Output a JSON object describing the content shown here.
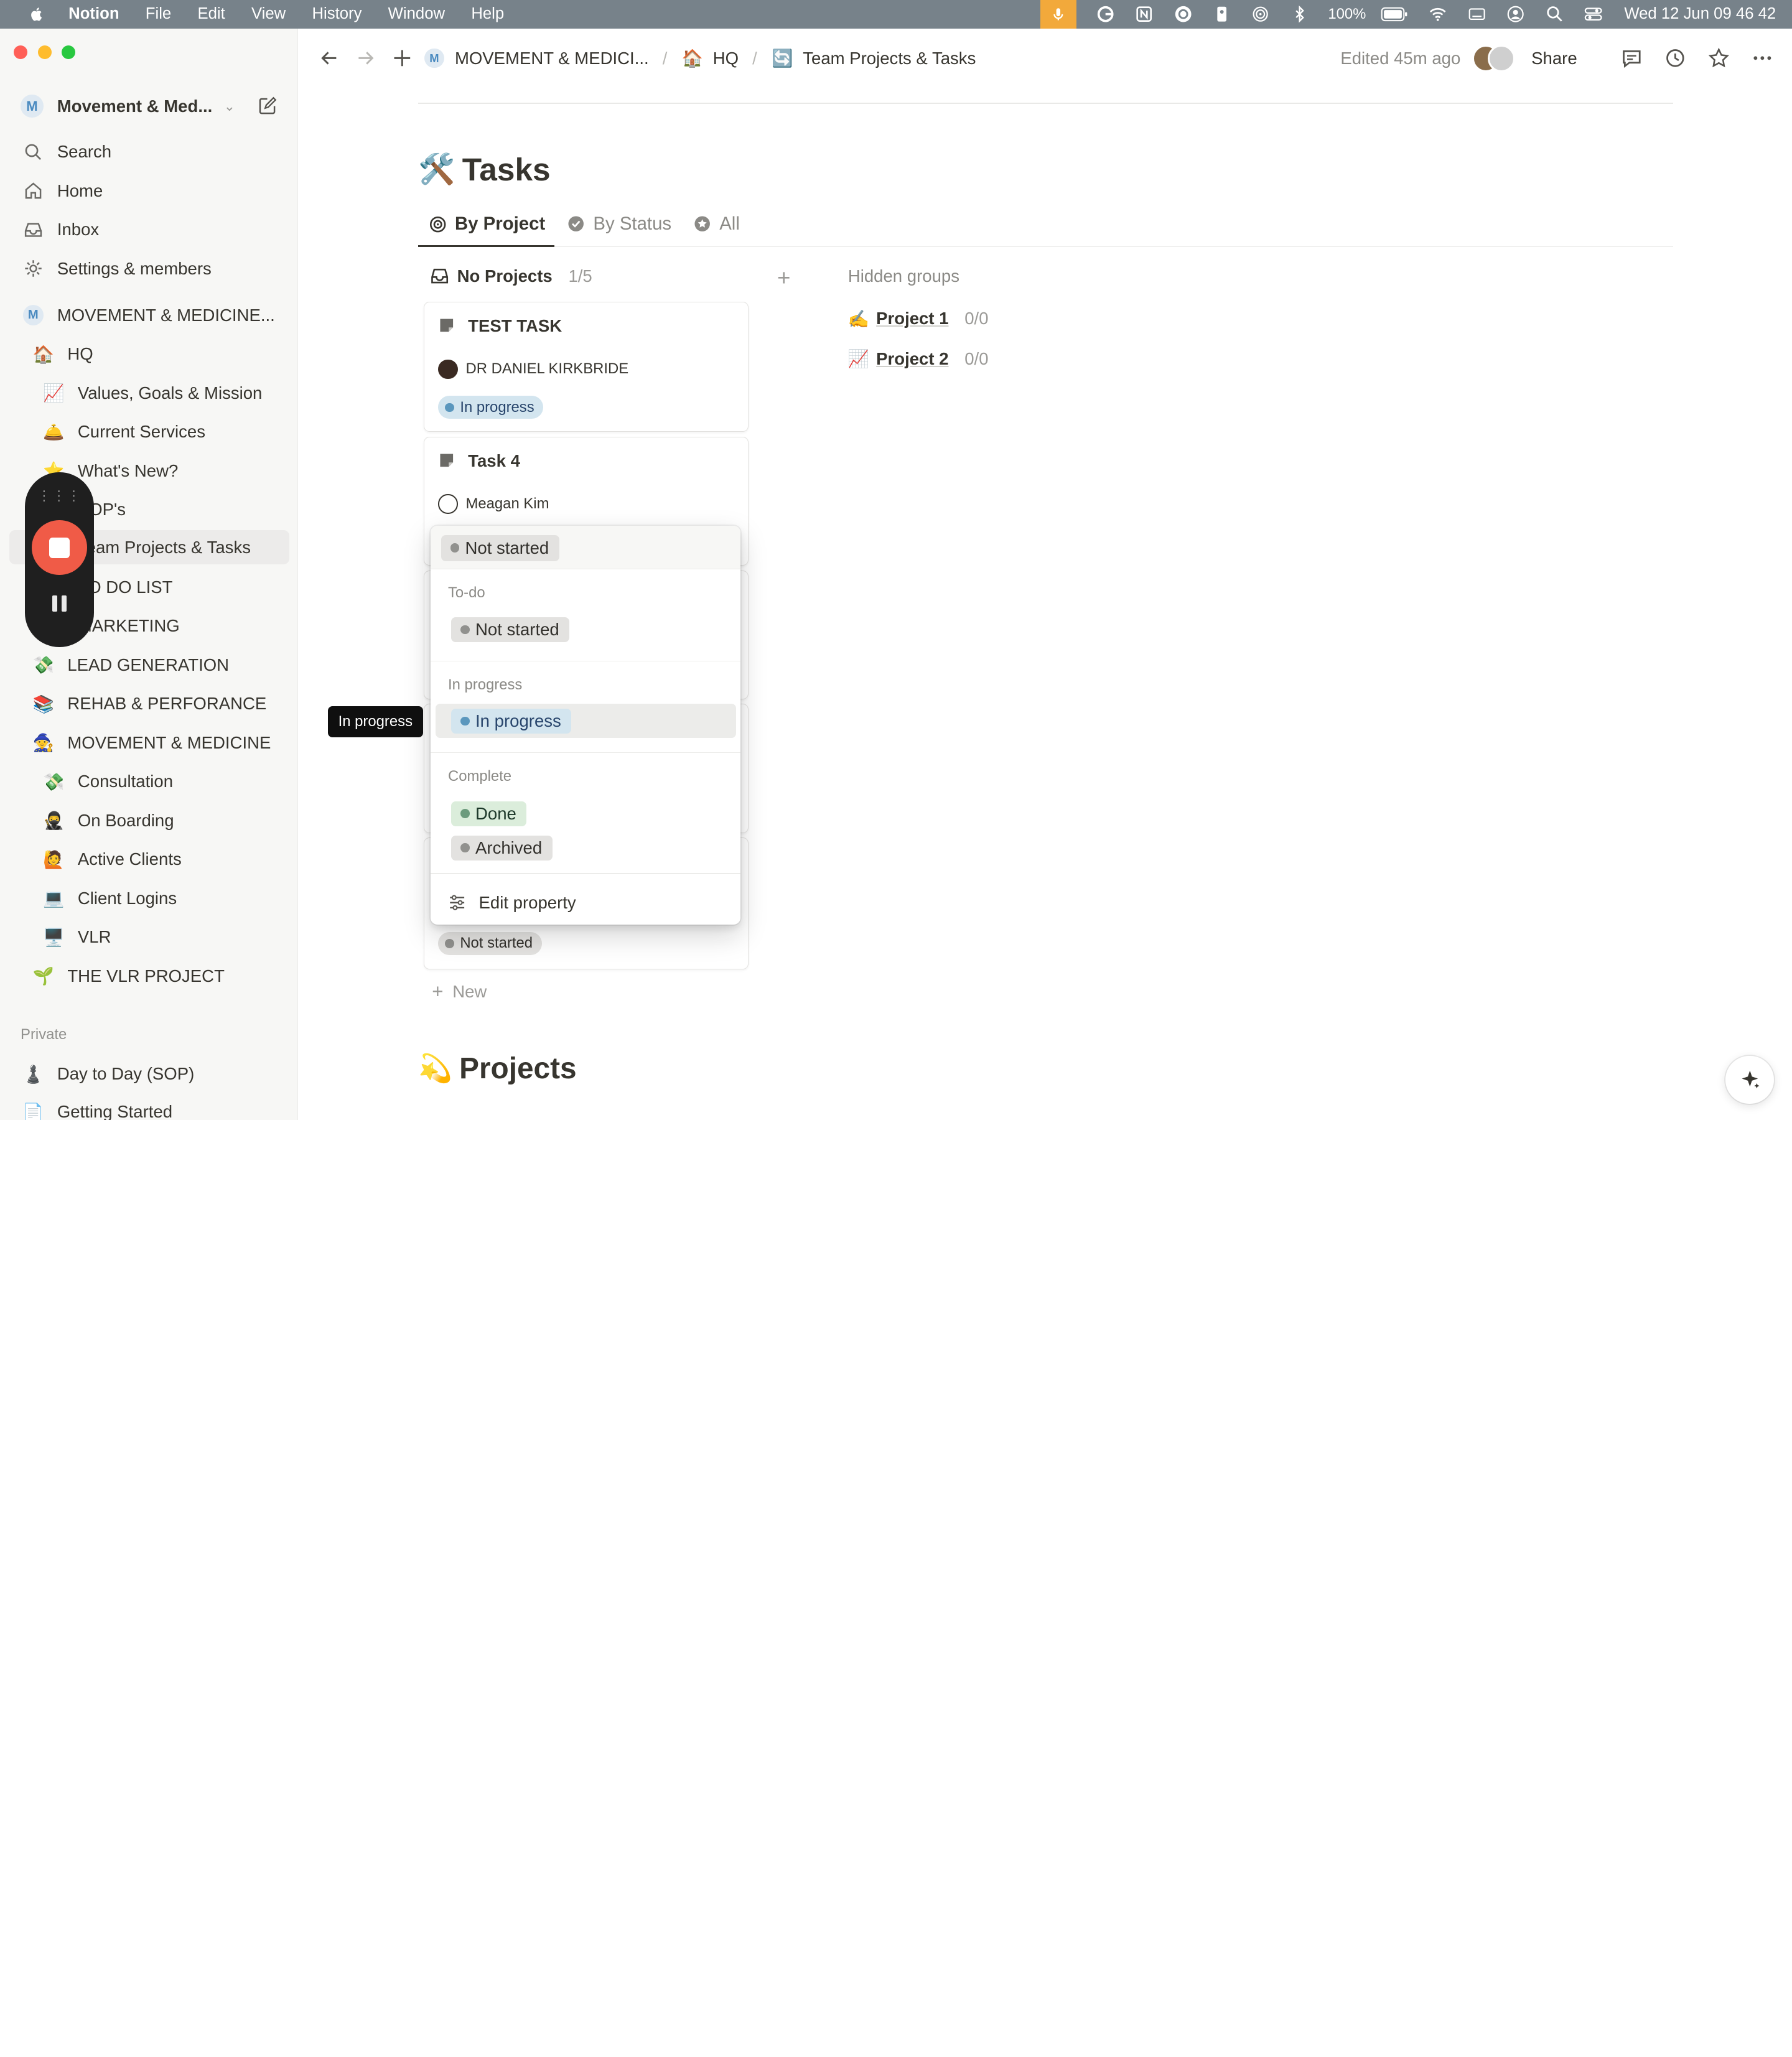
{
  "menubar": {
    "app": "Notion",
    "items": [
      "File",
      "Edit",
      "View",
      "History",
      "Window",
      "Help"
    ],
    "battery": "100%",
    "clock": "Wed 12 Jun  09 46 42"
  },
  "sidebar": {
    "workspace_name": "Movement & Med...",
    "nav": [
      {
        "label": "Search",
        "icon": "search-icon"
      },
      {
        "label": "Home",
        "icon": "home-icon"
      },
      {
        "label": "Inbox",
        "icon": "inbox-icon"
      },
      {
        "label": "Settings & members",
        "icon": "gear-icon"
      }
    ],
    "teamspace": "MOVEMENT & MEDICINE...",
    "pages": [
      {
        "emoji": "🏠",
        "label": "HQ"
      },
      {
        "emoji": "📈",
        "label": "Values, Goals & Mission"
      },
      {
        "emoji": "🛎️",
        "label": "Current Services"
      },
      {
        "emoji": "⭐",
        "label": "What's New?"
      },
      {
        "emoji": "📄",
        "label": "SOP's"
      },
      {
        "emoji": "🔄",
        "label": "Team Projects & Tasks"
      },
      {
        "emoji": "📝",
        "label": "TO DO LIST"
      },
      {
        "emoji": "📣",
        "label": "MARKETING"
      },
      {
        "emoji": "💸",
        "label": "LEAD GENERATION"
      },
      {
        "emoji": "📚",
        "label": "REHAB & PERFORANCE"
      },
      {
        "emoji": "🧙",
        "label": "MOVEMENT & MEDICINE"
      },
      {
        "emoji": "💸",
        "label": "Consultation"
      },
      {
        "emoji": "🥷",
        "label": "On Boarding"
      },
      {
        "emoji": "🙋",
        "label": "Active Clients"
      },
      {
        "emoji": "💻",
        "label": "Client Logins"
      },
      {
        "emoji": "🖥️",
        "label": "VLR"
      },
      {
        "emoji": "🌱",
        "label": "THE VLR PROJECT"
      }
    ],
    "private_label": "Private",
    "private_pages": [
      {
        "emoji": "♟️",
        "label": "Day to Day (SOP)"
      },
      {
        "emoji": "📄",
        "label": "Getting Started"
      }
    ]
  },
  "topbar": {
    "breadcrumbs": [
      {
        "emoji": "Ⓜ",
        "label": "MOVEMENT & MEDICI..."
      },
      {
        "emoji": "🏠",
        "label": "HQ"
      },
      {
        "emoji": "🔄",
        "label": "Team Projects & Tasks"
      }
    ],
    "edited": "Edited 45m ago",
    "share": "Share"
  },
  "main": {
    "title_emoji": "🛠️",
    "title": "Tasks",
    "tabs": [
      {
        "label": "By Project",
        "icon": "target-icon"
      },
      {
        "label": "By Status",
        "icon": "check-circle-icon"
      },
      {
        "label": "All",
        "icon": "star-icon"
      }
    ],
    "group": {
      "name": "No Projects",
      "count": "1/5"
    },
    "hidden_groups_title": "Hidden groups",
    "hidden_groups": [
      {
        "emoji": "✍️",
        "name": "Project 1",
        "count": "0/0"
      },
      {
        "emoji": "📈",
        "name": "Project 2",
        "count": "0/0"
      }
    ],
    "cards": [
      {
        "title": "TEST TASK",
        "person": "DR DANIEL KIRKBRIDE",
        "status": "In progress"
      },
      {
        "title": "Task 4",
        "person": "Meagan Kim",
        "status": "Not started"
      },
      {
        "status": "Not started"
      }
    ],
    "new_label": "New",
    "projects_emoji": "💫",
    "projects_title": "Projects"
  },
  "status_dropdown": {
    "current": "Not started",
    "sections": [
      {
        "label": "To-do",
        "options": [
          "Not started"
        ]
      },
      {
        "label": "In progress",
        "options": [
          "In progress"
        ]
      },
      {
        "label": "Complete",
        "options": [
          "Done",
          "Archived"
        ]
      }
    ],
    "edit_label": "Edit property"
  },
  "tooltip": "In progress",
  "colors": {
    "accent_blue": "#5b97bd",
    "record_red": "#f05b47",
    "menubar": "#77828a"
  }
}
